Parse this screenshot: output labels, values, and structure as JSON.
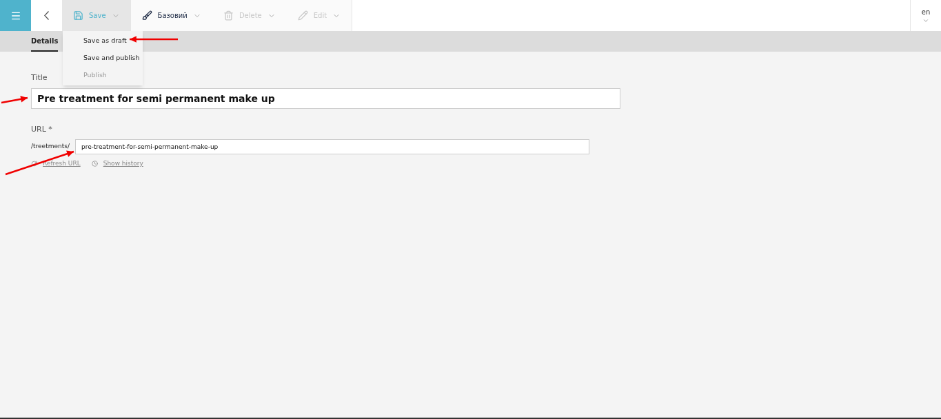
{
  "toolbar": [
    {
      "kind": "save",
      "label": "Save",
      "open": true,
      "disabled": false
    },
    {
      "kind": "brush",
      "label": "Базовий",
      "open": false,
      "disabled": false
    },
    {
      "kind": "trash",
      "label": "Delete",
      "open": false,
      "disabled": true
    },
    {
      "kind": "pencil",
      "label": "Edit",
      "open": false,
      "disabled": true
    }
  ],
  "save_menu": [
    {
      "label": "Save as draft",
      "disabled": false
    },
    {
      "label": "Save and publish",
      "disabled": false
    },
    {
      "label": "Publish",
      "disabled": true
    }
  ],
  "language": "en",
  "tabs": [
    {
      "label": "Details",
      "selected": true
    }
  ],
  "title_field": {
    "label": "Title",
    "value": "Pre treatment for semi permanent make up"
  },
  "url_field": {
    "label": "URL *",
    "prefix": "/treetments/",
    "value": "pre-treatment-for-semi-permanent-make-up"
  },
  "links": [
    {
      "kind": "refresh",
      "label": "Refresh URL"
    },
    {
      "kind": "history",
      "label": "Show history"
    }
  ]
}
